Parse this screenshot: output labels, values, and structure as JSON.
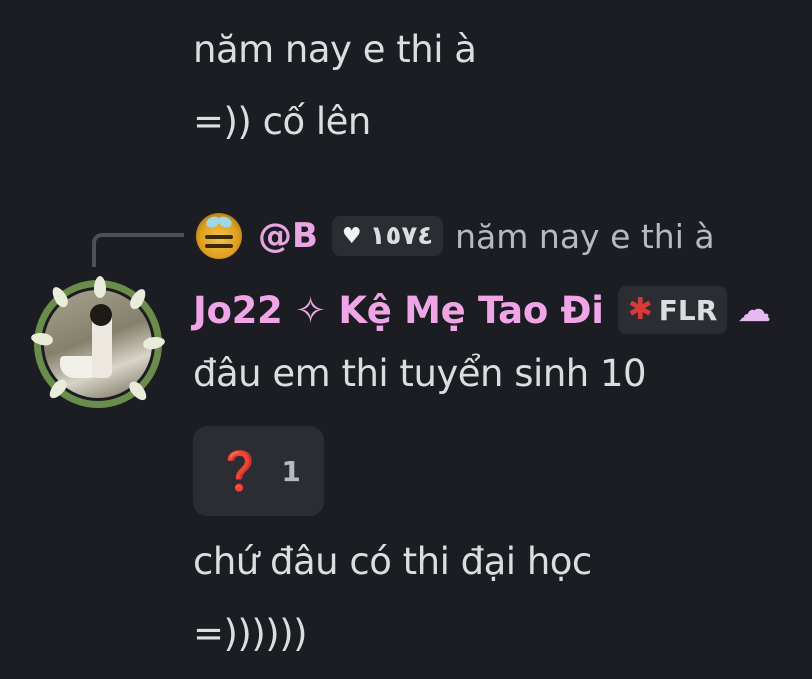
{
  "messages_above": [
    "năm nay e thi à",
    "=)) cố lên"
  ],
  "reply": {
    "avatar_icon": "bee-avatar-icon",
    "name": "@B",
    "tag_icon": "heart-icon",
    "tag_text": "١٥٧٤",
    "text": "năm nay e thi à"
  },
  "author": {
    "name": "Jo22 ✧ Kệ Mẹ Tao Đi",
    "clan_icon": "maple-leaf-icon",
    "clan_tag": "FLR",
    "decoration_icon": "cloud-icon",
    "color": "#f0a6e6"
  },
  "messages": [
    "đâu em thi tuyển sinh 10",
    "chứ đâu có thi đại học",
    "=))))))"
  ],
  "reaction": {
    "emoji": "❓",
    "count": "1",
    "emoji_color": "#e02e2e"
  }
}
